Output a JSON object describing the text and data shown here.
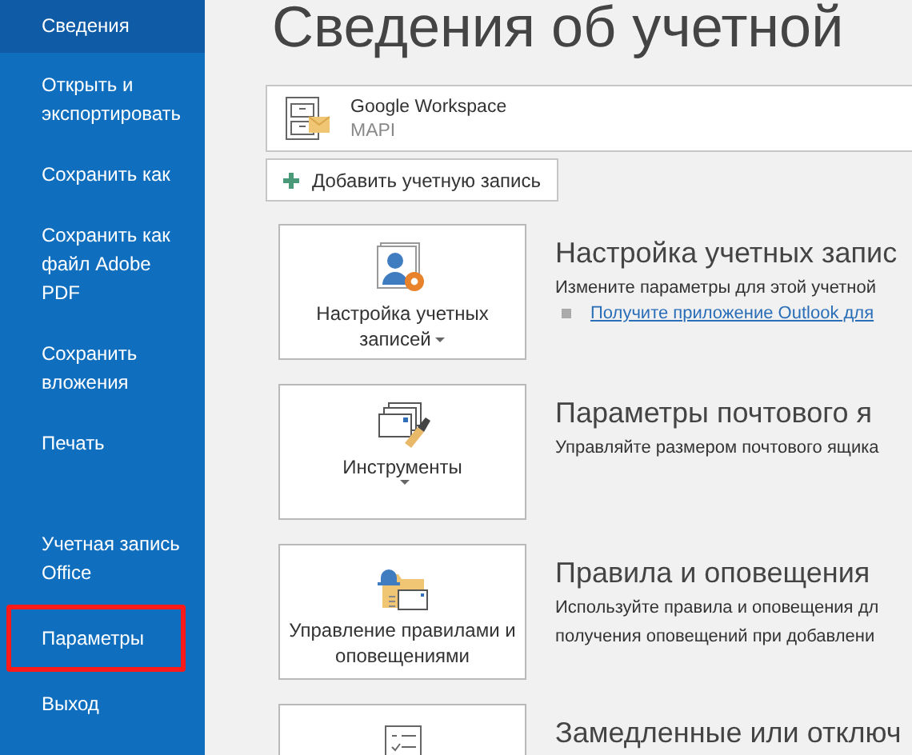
{
  "sidebar": {
    "items": [
      {
        "label": "Сведения",
        "selected": true,
        "highlighted": false
      },
      {
        "label": "Открыть и экспортировать",
        "selected": false,
        "highlighted": false
      },
      {
        "label": "Сохранить как",
        "selected": false,
        "highlighted": false
      },
      {
        "label": "Сохранить как файл Adobe PDF",
        "selected": false,
        "highlighted": false
      },
      {
        "label": "Сохранить вложения",
        "selected": false,
        "highlighted": false
      },
      {
        "label": "Печать",
        "selected": false,
        "highlighted": false
      }
    ],
    "footer_items": [
      {
        "label": "Учетная запись Office",
        "selected": false,
        "highlighted": false
      },
      {
        "label": "Параметры",
        "selected": false,
        "highlighted": true
      },
      {
        "label": "Выход",
        "selected": false,
        "highlighted": false
      }
    ]
  },
  "title": "Сведения об учетной",
  "account": {
    "name": "Google Workspace",
    "type": "MAPI"
  },
  "add_button": {
    "label": "Добавить учетную запись"
  },
  "sections": [
    {
      "kind": "accounts",
      "button_label": "Настройка учетных записей",
      "dropdown": true,
      "heading": "Настройка учетных запис",
      "description": [
        "Измените параметры для этой учетной"
      ],
      "link": "Получите приложение Outlook для"
    },
    {
      "kind": "tools",
      "button_label": "Инструменты",
      "dropdown": true,
      "heading": "Параметры почтового я",
      "description": [
        "Управляйте размером почтового ящика"
      ]
    },
    {
      "kind": "rules",
      "button_label": "Управление правилами и оповещениями",
      "dropdown": false,
      "heading": "Правила и оповещения",
      "description": [
        "Используйте правила и оповещения дл",
        "получения оповещений при добавлени"
      ]
    },
    {
      "kind": "addins",
      "heading": "Замедленные или отключ"
    }
  ]
}
